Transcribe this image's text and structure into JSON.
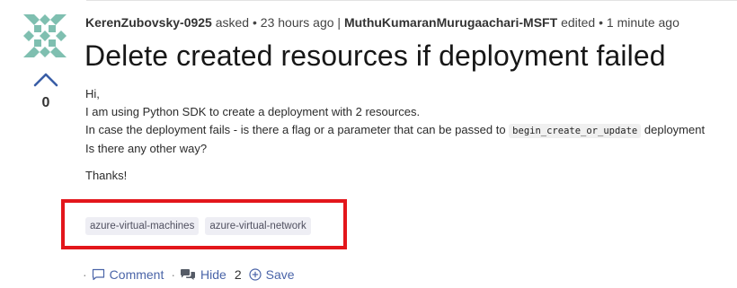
{
  "question": {
    "author": "KerenZubovsky-0925",
    "asked_label": "asked",
    "asked_time": "23 hours ago",
    "editor": "MuthuKumaranMurugaachari-MSFT",
    "edited_label": "edited",
    "edited_time": "1 minute ago",
    "separator_dot": "•",
    "separator_bar": "|",
    "title": "Delete created resources if deployment failed",
    "vote_count": "0",
    "body": {
      "line1": "Hi,",
      "line2": "I am using Python SDK to create a deployment with 2 resources.",
      "line3_before": "In case the deployment fails - is there a flag or a parameter that can be passed to",
      "line3_code": "begin_create_or_update",
      "line3_after": "deployment",
      "line4": "Is there any other way?",
      "line5": "Thanks!"
    },
    "tags": [
      "azure-virtual-machines",
      "azure-virtual-network"
    ]
  },
  "actions": {
    "leading_dot": "·",
    "comment_label": "Comment",
    "mid_dot": "·",
    "hide_label": "Hide",
    "hide_count": "2",
    "save_label": "Save"
  },
  "colors": {
    "highlight_border": "#e3161b",
    "link": "#4a64a8",
    "vote_arrow": "#3a5ea6"
  },
  "icons": {
    "avatar": "identicon-avatar",
    "vote_up": "chevron-up-icon",
    "comment": "comment-icon",
    "hide": "comments-icon",
    "save": "plus-circle-icon"
  }
}
